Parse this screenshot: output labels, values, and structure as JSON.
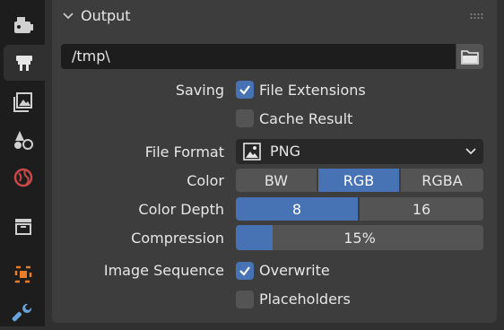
{
  "sidebar": {
    "tabs": [
      {
        "icon": "render-icon",
        "active": false
      },
      {
        "icon": "output-icon",
        "active": true
      },
      {
        "icon": "view-layer-icon",
        "active": false
      },
      {
        "icon": "scene-icon",
        "active": false
      },
      {
        "icon": "world-icon",
        "active": false
      },
      {
        "icon": "collection-icon",
        "active": false
      },
      {
        "icon": "object-icon",
        "active": false
      },
      {
        "icon": "modifier-wrench-icon",
        "active": false
      }
    ]
  },
  "panel": {
    "title": "Output",
    "output_path": "/tmp\\",
    "saving": {
      "label": "Saving",
      "file_extensions": {
        "label": "File Extensions",
        "checked": true
      },
      "cache_result": {
        "label": "Cache Result",
        "checked": false
      }
    },
    "file_format": {
      "label": "File Format",
      "value": "PNG"
    },
    "color": {
      "label": "Color",
      "options": [
        "BW",
        "RGB",
        "RGBA"
      ],
      "selected": "RGB"
    },
    "color_depth": {
      "label": "Color Depth",
      "options": [
        "8",
        "16"
      ],
      "selected": "8"
    },
    "compression": {
      "label": "Compression",
      "value_text": "15%",
      "fraction": 0.15
    },
    "image_sequence": {
      "label": "Image Sequence",
      "overwrite": {
        "label": "Overwrite",
        "checked": true
      },
      "placeholders": {
        "label": "Placeholders",
        "checked": false
      }
    }
  },
  "colors": {
    "accent": "#4772b3",
    "panel_bg": "#3d3d3d",
    "field_bg": "#1d1d1d",
    "button_bg": "#545454"
  }
}
